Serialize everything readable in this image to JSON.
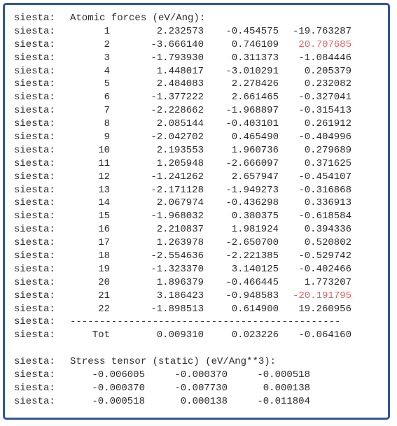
{
  "header": {
    "prefix": "siesta:",
    "title": "Atomic forces (eV/Ang):"
  },
  "forces": [
    {
      "index": "1",
      "fx": "2.232573",
      "fy": "-0.454575",
      "fz": "-19.763287",
      "fz_highlight": false
    },
    {
      "index": "2",
      "fx": "-3.666140",
      "fy": "0.746109",
      "fz": "20.707685",
      "fz_highlight": true
    },
    {
      "index": "3",
      "fx": "-1.793930",
      "fy": "0.311373",
      "fz": "-1.084446",
      "fz_highlight": false
    },
    {
      "index": "4",
      "fx": "1.448017",
      "fy": "-3.010291",
      "fz": "0.205379",
      "fz_highlight": false
    },
    {
      "index": "5",
      "fx": "2.484083",
      "fy": "2.278426",
      "fz": "0.232082",
      "fz_highlight": false
    },
    {
      "index": "6",
      "fx": "-1.377222",
      "fy": "2.661465",
      "fz": "-0.327041",
      "fz_highlight": false
    },
    {
      "index": "7",
      "fx": "-2.228662",
      "fy": "-1.968897",
      "fz": "-0.315413",
      "fz_highlight": false
    },
    {
      "index": "8",
      "fx": "2.085144",
      "fy": "-0.403101",
      "fz": "0.261912",
      "fz_highlight": false
    },
    {
      "index": "9",
      "fx": "-2.042702",
      "fy": "0.465490",
      "fz": "-0.404996",
      "fz_highlight": false
    },
    {
      "index": "10",
      "fx": "2.193553",
      "fy": "1.960736",
      "fz": "0.279689",
      "fz_highlight": false
    },
    {
      "index": "11",
      "fx": "1.205948",
      "fy": "-2.666097",
      "fz": "0.371625",
      "fz_highlight": false
    },
    {
      "index": "12",
      "fx": "-1.241262",
      "fy": "2.657947",
      "fz": "-0.454107",
      "fz_highlight": false
    },
    {
      "index": "13",
      "fx": "-2.171128",
      "fy": "-1.949273",
      "fz": "-0.316868",
      "fz_highlight": false
    },
    {
      "index": "14",
      "fx": "2.067974",
      "fy": "-0.436298",
      "fz": "0.336913",
      "fz_highlight": false
    },
    {
      "index": "15",
      "fx": "-1.968032",
      "fy": "0.380375",
      "fz": "-0.618584",
      "fz_highlight": false
    },
    {
      "index": "16",
      "fx": "2.210837",
      "fy": "1.981924",
      "fz": "0.394336",
      "fz_highlight": false
    },
    {
      "index": "17",
      "fx": "1.263978",
      "fy": "-2.650700",
      "fz": "0.520802",
      "fz_highlight": false
    },
    {
      "index": "18",
      "fx": "-2.554636",
      "fy": "-2.221385",
      "fz": "-0.529742",
      "fz_highlight": false
    },
    {
      "index": "19",
      "fx": "-1.323370",
      "fy": "3.140125",
      "fz": "-0.402466",
      "fz_highlight": false
    },
    {
      "index": "20",
      "fx": "1.896379",
      "fy": "-0.466445",
      "fz": "1.773207",
      "fz_highlight": false
    },
    {
      "index": "21",
      "fx": "3.186423",
      "fy": "-0.948583",
      "fz": "-20.191795",
      "fz_highlight": true
    },
    {
      "index": "22",
      "fx": "-1.898513",
      "fy": "0.614900",
      "fz": "19.260956",
      "fz_highlight": false
    }
  ],
  "separator": "----------------------------------------------",
  "total": {
    "label": "Tot",
    "fx": "0.009310",
    "fy": "0.023226",
    "fz": "-0.064160"
  },
  "stress": {
    "title": "Stress tensor (static) (eV/Ang**3):",
    "rows": [
      [
        "-0.006005",
        "-0.000370",
        "-0.000518"
      ],
      [
        "-0.000370",
        "-0.007730",
        "0.000138"
      ],
      [
        "-0.000518",
        "0.000138",
        "-0.011804"
      ]
    ]
  },
  "colors": {
    "border": "#2f5597",
    "text": "#2b2b2b",
    "highlight": "#e06060"
  }
}
